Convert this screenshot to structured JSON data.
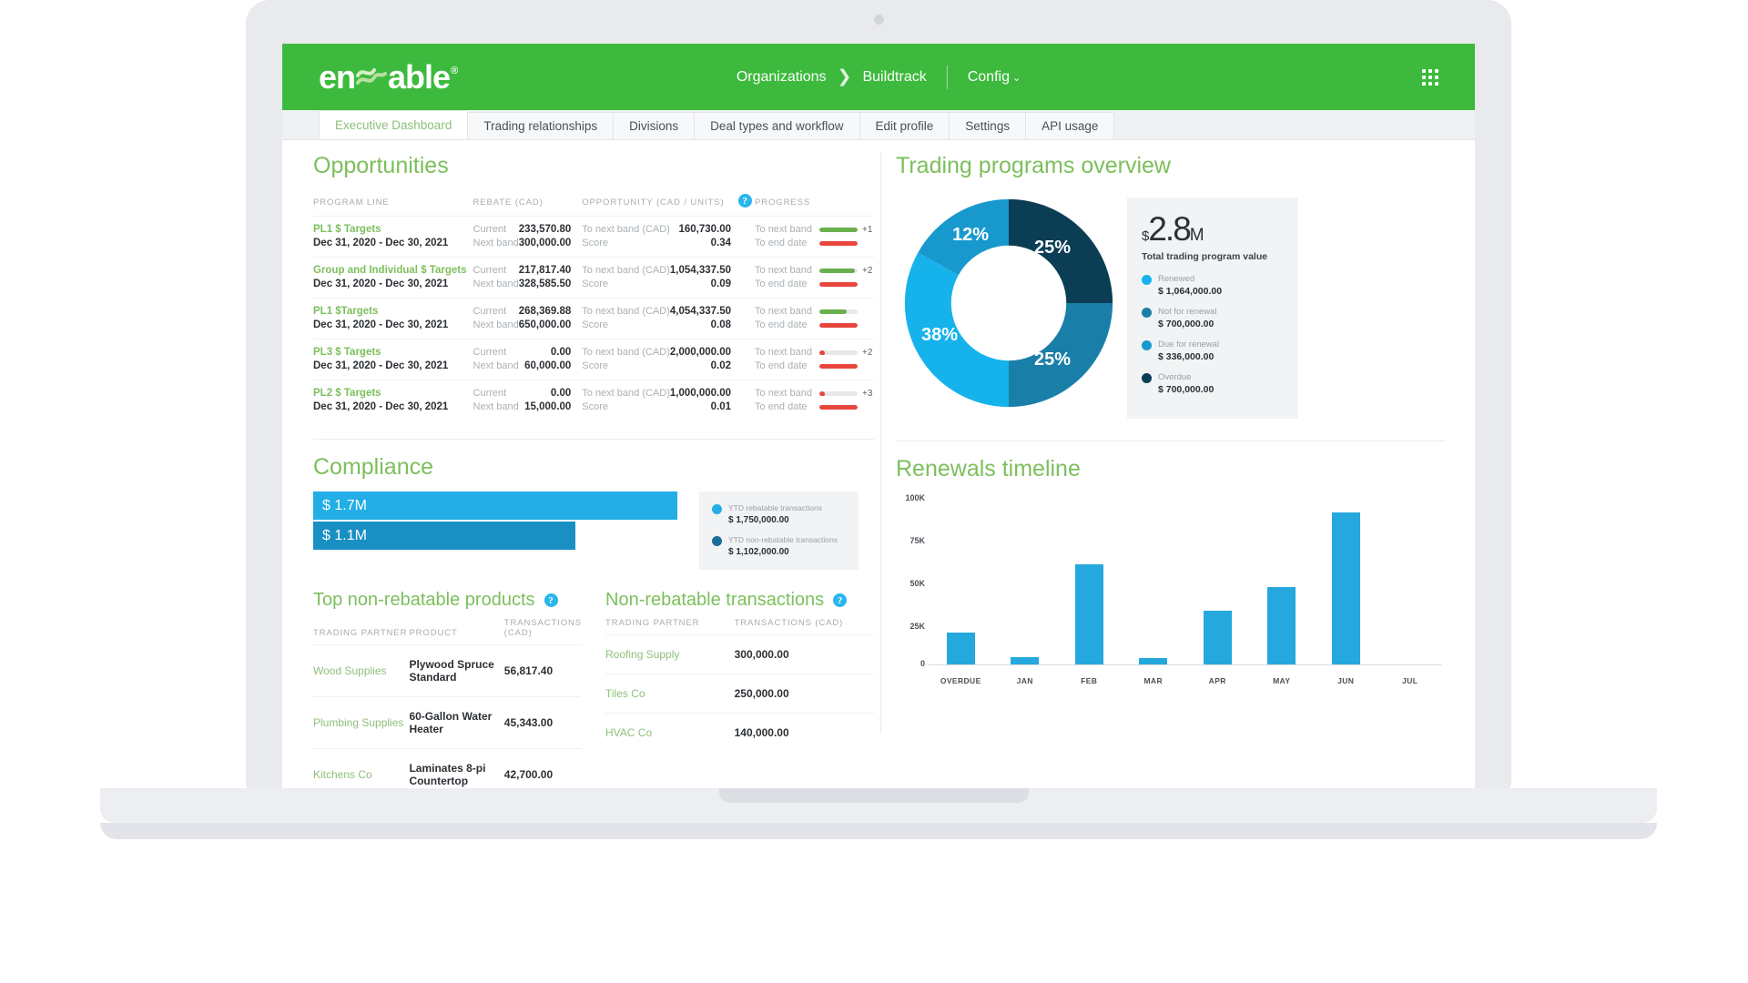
{
  "brand": {
    "name_left": "en",
    "name_right": "able",
    "reg": "®"
  },
  "topnav": {
    "organizations": "Organizations",
    "chevron": "❯",
    "buildtrack": "Buildtrack",
    "config": "Config",
    "caret": "⌄"
  },
  "tabs": [
    {
      "label": "Executive Dashboard",
      "active": true
    },
    {
      "label": "Trading relationships",
      "active": false
    },
    {
      "label": "Divisions",
      "active": false
    },
    {
      "label": "Deal types and workflow",
      "active": false
    },
    {
      "label": "Edit profile",
      "active": false
    },
    {
      "label": "Settings",
      "active": false
    },
    {
      "label": "API usage",
      "active": false
    }
  ],
  "opportunities": {
    "title": "Opportunities",
    "columns": {
      "program_line": "PROGRAM LINE",
      "rebate": "REBATE (CAD)",
      "opportunity": "OPPORTUNITY (CAD / UNITS)",
      "progress": "PROGRESS"
    },
    "help_glyph": "?",
    "labels": {
      "current": "Current",
      "next_band": "Next band",
      "to_next_band_cad": "To next band (CAD)",
      "score": "Score",
      "to_next_band": "To next band",
      "to_end_date": "To end date"
    },
    "rows": [
      {
        "name": "PL1 $ Targets",
        "dates": "Dec 31, 2020 - Dec 30, 2021",
        "current": "233,570.80",
        "next_band": "300,000.00",
        "to_next_band_cad": "160,730.00",
        "score": "0.34",
        "band_pct": 100,
        "band_color": "#6ab04c",
        "end_pct": 100,
        "end_color": "#e8453c",
        "plus": "+1",
        "band_dot": false
      },
      {
        "name": "Group and Individual $ Targets",
        "dates": "Dec 31, 2020 - Dec 30, 2021",
        "current": "217,817.40",
        "next_band": "328,585.50",
        "to_next_band_cad": "1,054,337.50",
        "score": "0.09",
        "band_pct": 92,
        "band_color": "#6ab04c",
        "end_pct": 100,
        "end_color": "#e8453c",
        "plus": "+2",
        "band_dot": false
      },
      {
        "name": "PL1 $Targets",
        "dates": "Dec 31, 2020 - Dec 30, 2021",
        "current": "268,369.88",
        "next_band": "650,000.00",
        "to_next_band_cad": "4,054,337.50",
        "score": "0.08",
        "band_pct": 71,
        "band_color": "#6ab04c",
        "end_pct": 100,
        "end_color": "#e8453c",
        "plus": "",
        "band_dot": false
      },
      {
        "name": "PL3 $ Targets",
        "dates": "Dec 31, 2020 - Dec 30, 2021",
        "current": "0.00",
        "next_band": "60,000.00",
        "to_next_band_cad": "2,000,000.00",
        "score": "0.02",
        "band_pct": 0,
        "band_color": "#e8453c",
        "end_pct": 100,
        "end_color": "#e8453c",
        "plus": "+2",
        "band_dot": true
      },
      {
        "name": "PL2 $ Targets",
        "dates": "Dec 31, 2020 - Dec 30, 2021",
        "current": "0.00",
        "next_band": "15,000.00",
        "to_next_band_cad": "1,000,000.00",
        "score": "0.01",
        "band_pct": 0,
        "band_color": "#e8453c",
        "end_pct": 100,
        "end_color": "#e8453c",
        "plus": "+3",
        "band_dot": true
      }
    ]
  },
  "trading_programs": {
    "title": "Trading programs overview",
    "kpi_currency": "$",
    "kpi_value": "2.8",
    "kpi_unit": "M",
    "kpi_caption": "Total trading program value",
    "legend": [
      {
        "name": "Renewed",
        "value": "$ 1,064,000.00",
        "color": "#16b2ec"
      },
      {
        "name": "Not for renewal",
        "value": "$ 700,000.00",
        "color": "#1a7fa8"
      },
      {
        "name": "Due for renewal",
        "value": "$ 336,000.00",
        "color": "#1899cd"
      },
      {
        "name": "Overdue",
        "value": "$ 700,000.00",
        "color": "#0b3e55"
      }
    ],
    "slice_labels": [
      "25%",
      "25%",
      "38%",
      "12%"
    ]
  },
  "compliance": {
    "title": "Compliance",
    "bars": [
      {
        "label": "$ 1.7M",
        "pct": 100,
        "color": "#23aee6"
      },
      {
        "label": "$ 1.1M",
        "pct": 72,
        "color": "#1a8fc4"
      }
    ],
    "legend": [
      {
        "name": "YTD rebatable transactions",
        "value": "$ 1,750,000.00",
        "color": "#23aee6"
      },
      {
        "name": "YTD non-rebatable transactions",
        "value": "$ 1,102,000.00",
        "color": "#1a6f96"
      }
    ]
  },
  "top_products": {
    "title": "Top non-rebatable products",
    "help_glyph": "?",
    "columns": [
      "TRADING PARTNER",
      "PRODUCT",
      "TRANSACTIONS (CAD)"
    ],
    "rows": [
      {
        "partner": "Wood Supplies",
        "product": "Plywood Spruce Standard",
        "amount": "56,817.40"
      },
      {
        "partner": "Plumbing Supplies",
        "product": "60-Gallon Water Heater",
        "amount": "45,343.00"
      },
      {
        "partner": "Kitchens Co",
        "product": "Laminates 8-pi Countertop",
        "amount": "42,700.00"
      }
    ]
  },
  "non_rebatable": {
    "title": "Non-rebatable transactions",
    "help_glyph": "?",
    "columns": [
      "TRADING PARTNER",
      "TRANSACTIONS (CAD)"
    ],
    "rows": [
      {
        "partner": "Roofing Supply",
        "amount": "300,000.00"
      },
      {
        "partner": "Tiles Co",
        "amount": "250,000.00"
      },
      {
        "partner": "HVAC Co",
        "amount": "140,000.00"
      }
    ]
  },
  "renewals": {
    "title": "Renewals timeline"
  },
  "chart_data": [
    {
      "type": "pie",
      "title": "Trading programs overview",
      "labels": [
        "Not for renewal",
        "Due for renewal",
        "Renewed",
        "Overdue"
      ],
      "percents": [
        25,
        25,
        38,
        12
      ],
      "values": [
        700000,
        336000,
        1064000,
        700000
      ],
      "colors": [
        "#0b3e55",
        "#1a7fa8",
        "#16b2ec",
        "#1899cd"
      ],
      "legend_position": "right",
      "total": "2.8M"
    },
    {
      "type": "bar",
      "title": "Compliance",
      "categories": [
        "YTD rebatable transactions",
        "YTD non-rebatable transactions"
      ],
      "values": [
        1750000,
        1102000
      ],
      "data_labels": [
        "$ 1.7M",
        "$ 1.1M"
      ],
      "colors": [
        "#23aee6",
        "#1a8fc4"
      ],
      "orientation": "horizontal",
      "grid": false
    },
    {
      "type": "bar",
      "title": "Renewals timeline",
      "categories": [
        "OVERDUE",
        "JAN",
        "FEB",
        "MAR",
        "APR",
        "MAY",
        "JUN",
        "JUL"
      ],
      "values": [
        19000,
        4500,
        60000,
        4000,
        32000,
        46000,
        91000,
        0
      ],
      "ytick_labels": [
        "0",
        "25K",
        "50K",
        "75K",
        "100K"
      ],
      "yticks": [
        0,
        25000,
        50000,
        75000,
        100000
      ],
      "ylim": [
        0,
        100000
      ],
      "xlabel": "",
      "ylabel": "",
      "grid": false,
      "color": "#25a8dd"
    }
  ]
}
